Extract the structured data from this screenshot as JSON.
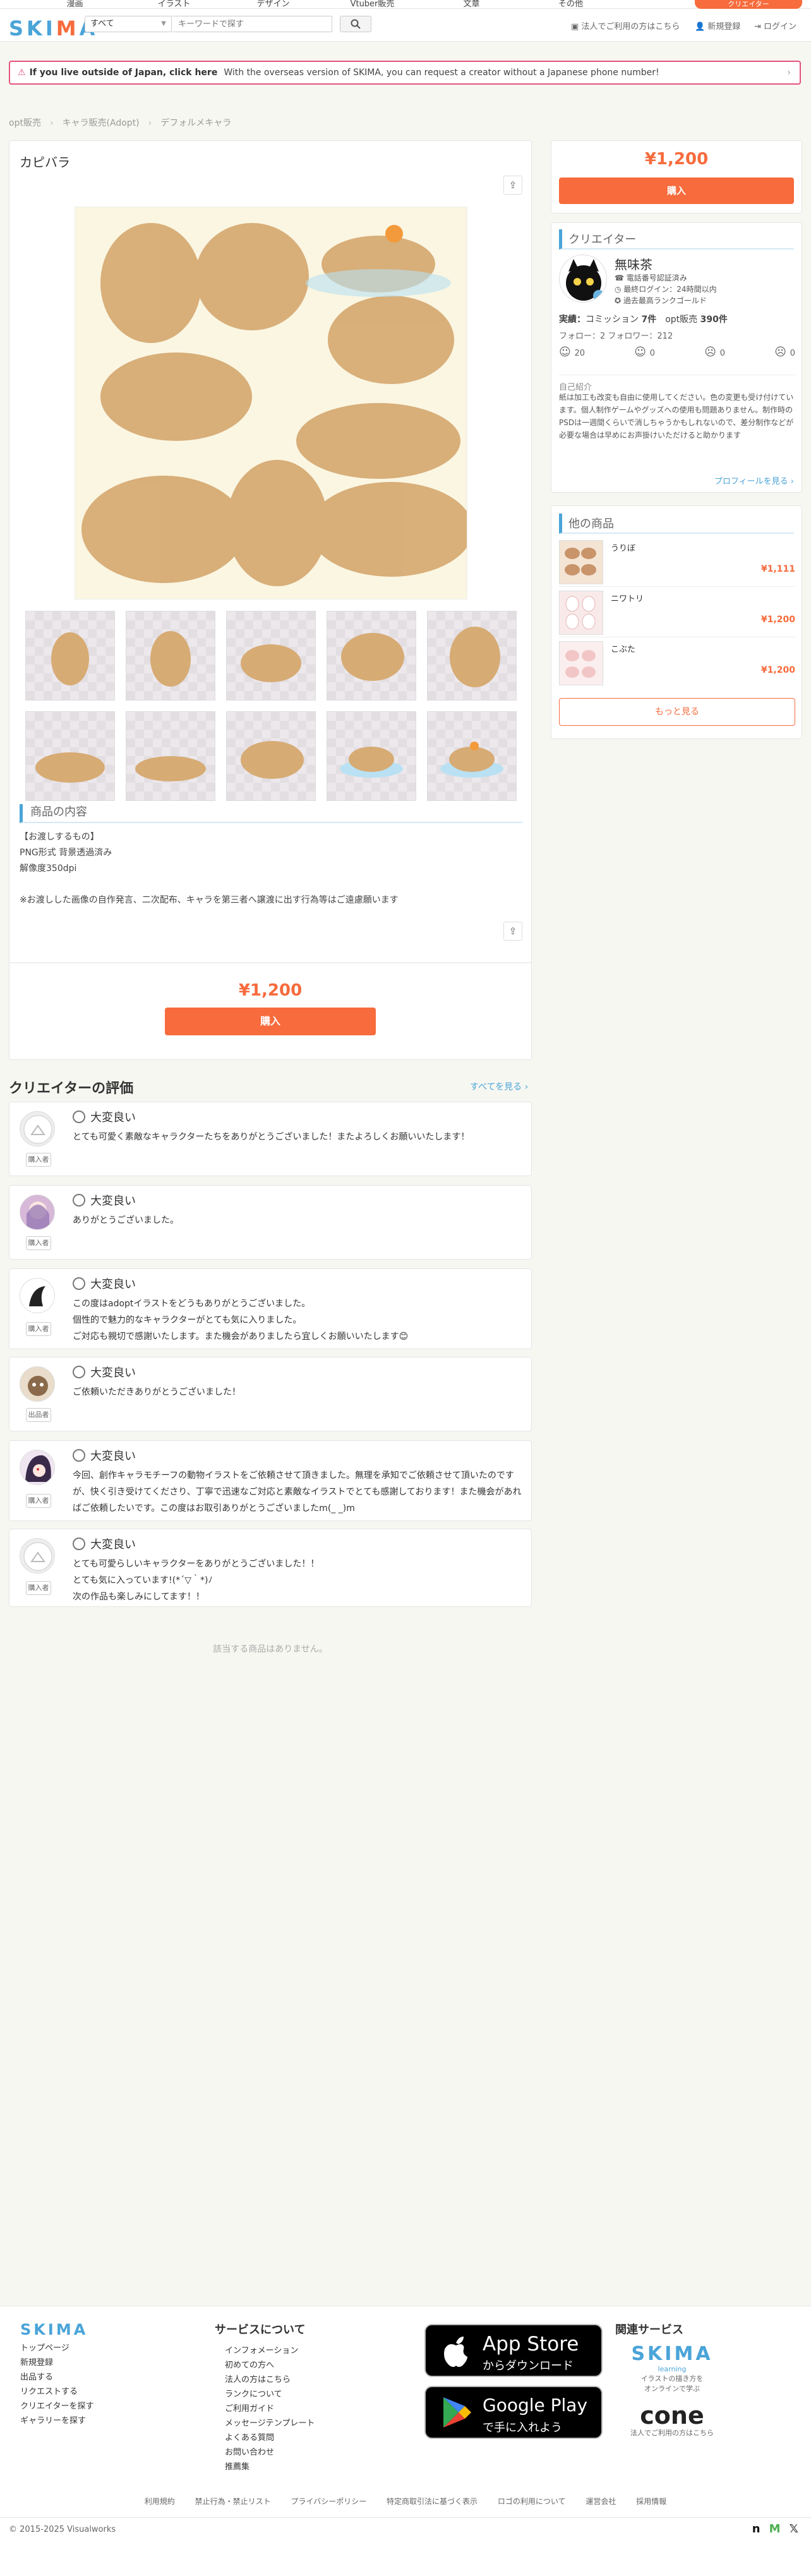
{
  "top_categories": [
    "漫画",
    "イラスト",
    "デザイン",
    "Vtuber販売",
    "文章",
    "その他"
  ],
  "top_cta": "クリエイター",
  "header": {
    "logo": "SKIMA",
    "scope_selected": "すべて",
    "search_placeholder": "キーワードで探す",
    "corp_link": "法人でご利用の方はこちら",
    "signup": "新規登録",
    "login": "ログイン"
  },
  "notice": {
    "strong": "If you live outside of Japan, click here",
    "text": "With the overseas version of SKIMA, you can request a creator without a Japanese phone number!"
  },
  "breadcrumb": [
    "opt販売",
    "キャラ販売(Adopt)",
    "デフォルメキャラ"
  ],
  "product": {
    "title": "カピバラ",
    "section_title": "商品の内容",
    "desc": [
      "【お渡しするもの】",
      "PNG形式 背景透過済み",
      "解像度350dpi",
      "",
      "※お渡しした画像の自作発言、二次配布、キャラを第三者へ譲渡に出す行為等はご遠慮願います"
    ],
    "price": "¥1,200",
    "buy": "購入"
  },
  "sidebar": {
    "price": "¥1,200",
    "buy": "購入",
    "creator_heading": "クリエイター",
    "creator_name": "無味茶",
    "badges": [
      "電話番号認証済み",
      "最終ログイン：24時間以内",
      "過去最高ランクゴールド"
    ],
    "stats_line1": [
      "実績：",
      "コミッション",
      "7件",
      "opt販売",
      "390件"
    ],
    "follow": "フォロー：2 フォロワー：212",
    "ratings": [
      "20",
      "0",
      "0",
      "0"
    ],
    "intro_heading": "自己紹介",
    "intro": "紙は加工も改変も自由に使用してください。色の変更も受け付けています。個人制作ゲームやグッズへの使用も問題ありません。制作時のPSDは一週間くらいで消しちゃうかもしれないので、差分制作などが必要な場合は早めにお声掛けいただけると助かります",
    "profile_link": "プロフィールを見る",
    "other_heading": "他の商品",
    "others": [
      {
        "name": "うりぼ",
        "price": "¥1,111"
      },
      {
        "name": "ニワトリ",
        "price": "¥1,200"
      },
      {
        "name": "こぶた",
        "price": "¥1,200"
      }
    ],
    "more": "もっと見る"
  },
  "reviews": {
    "heading": "クリエイターの評価",
    "see_all": "すべてを見る",
    "items": [
      {
        "rating": "大変良い",
        "role": "購入者",
        "text": "とても可愛く素敵なキャラクターたちをありがとうございました！またよろしくお願いいたします！"
      },
      {
        "rating": "大変良い",
        "role": "購入者",
        "text": "ありがとうございました。"
      },
      {
        "rating": "大変良い",
        "role": "購入者",
        "text": "この度はadoptイラストをどうもありがとうございました。\n個性的で魅力的なキャラクターがとても気に入りました。\nご対応も親切で感謝いたします。また機会がありましたら宜しくお願いいたします😊"
      },
      {
        "rating": "大変良い",
        "role": "出品者",
        "text": "ご依頼いただきありがとうございました！"
      },
      {
        "rating": "大変良い",
        "role": "購入者",
        "text": "今回、創作キャラモチーフの動物イラストをご依頼させて頂きました。無理を承知でご依頼させて頂いたのですが、快く引き受けてくださり、丁寧で迅速なご対応と素敵なイラストでとても感謝しております！また機会があればご依頼したいです。この度はお取引ありがとうございましたm(_ _)m"
      },
      {
        "rating": "大変良い",
        "role": "購入者",
        "text": "とても可愛らしいキャラクターをありがとうございました！！\nとても気に入っています!(*´▽｀*)ﾉ\n次の作品も楽しみにしてます！！"
      }
    ]
  },
  "no_items": "該当する商品はありません。",
  "footer": {
    "logo": "SKIMA",
    "links": [
      "トップページ",
      "新規登録",
      "出品する",
      "リクエストする",
      "クリエイターを探す",
      "ギャラリーを探す"
    ],
    "about_heading": "サービスについて",
    "about": [
      "インフォメーション",
      "初めての方へ",
      "法人の方はこちら",
      "ランクについて",
      "ご利用ガイド",
      "メッセージテンプレート",
      "よくある質問",
      "お問い合わせ",
      "推薦集"
    ],
    "appstore": {
      "big": "App Store",
      "small": "からダウンロード"
    },
    "googleplay": {
      "big": "Google Play",
      "small": "で手に入れよう"
    },
    "related_heading": "関連サービス",
    "related1": {
      "name": "SKIMA",
      "sub": "learning",
      "desc1": "イラストの描き方を",
      "desc2": "オンラインで学ぶ"
    },
    "related2": {
      "name": "cone",
      "desc": "法人でご利用の方はこちら"
    },
    "bottom_links": [
      "利用規約",
      "禁止行為・禁止リスト",
      "プライバシーポリシー",
      "特定商取引法に基づく表示",
      "ロゴの利用について",
      "運営会社",
      "採用情報"
    ],
    "copyright": "© 2015-2025 Visualworks"
  },
  "colors": {
    "accent": "#f76b3c",
    "blue": "#4aa4d8",
    "capybara": "#d7ab74",
    "notice": "#e3537a"
  }
}
